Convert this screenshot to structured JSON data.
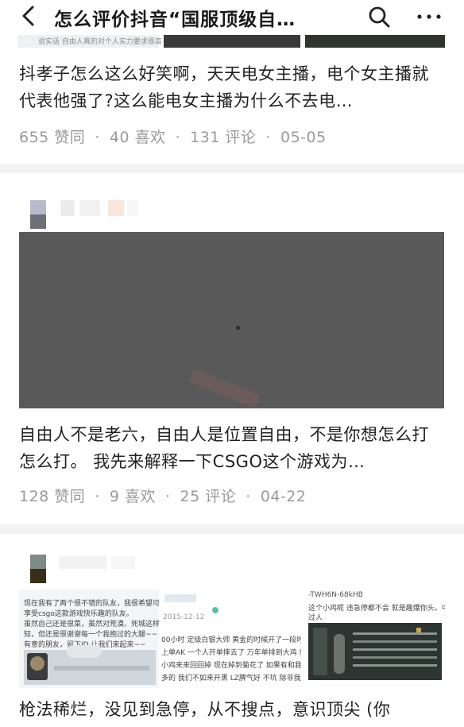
{
  "header": {
    "title": "怎么评价抖音“国服顶级自…",
    "back_icon": "chevron-left-icon",
    "search_icon": "search-icon",
    "more_icon": "more-dots-icon"
  },
  "strip": {
    "caption": "说实话 自由人真的对个人实力要求很高"
  },
  "answers": [
    {
      "text": "抖孝子怎么这么好笑啊，天天电女主播，电个女主播就代表他强了?这么能电女主播为什么不去电…",
      "likes": "655 赞同",
      "favorites": "40 喜欢",
      "comments": "131 评论",
      "date": "05-05"
    },
    {
      "text": "自由人不是老六，自由人是位置自由，不是你想怎么打怎么打。 我先来解释一下CSGO这个游戏为…",
      "likes": "128 赞同",
      "favorites": "9 喜欢",
      "comments": "25 评论",
      "date": "04-22"
    },
    {
      "text": "枪法稀烂，没见到急停，从不搜点，意识顶尖 (你",
      "image1_lines": [
        "现在我有了两个很不错的队友，我很希望可以再找两个",
        "享受csgo这款游戏快乐趣的队友。",
        "虽然自己还是很菜，虽然对荒漠、死城这样的图缺乏认",
        "知，但还是很谢谢每一个我抱过的大腿~~",
        "有意的朋友，留下ID 让我们来起来~~"
      ],
      "image2_date": "2015-12-12",
      "image2_lines": [
        "00小时 定级白银大师 黄金的时候开了一段时",
        "上单AK 一个人开单摔去了 万年单排到大鸡 然",
        "小鸡来来回回掉 现在掉到菊花了 如果有和我",
        "多的 我们不如来开黑 LZ脾气好 不坑 除非我卡"
      ],
      "image3_id": "-TWH6N-68kHB",
      "image3_lines": [
        "这个小鸡呢 违急停都不会 就是趣爆你头。中路门框不",
        "过人"
      ]
    }
  ]
}
